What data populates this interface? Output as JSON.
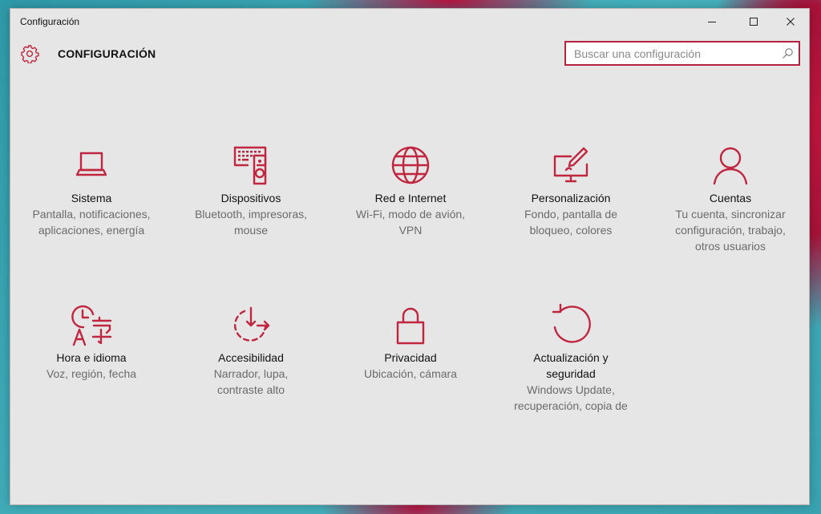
{
  "window": {
    "title": "Configuración"
  },
  "header": {
    "title": "CONFIGURACIÓN"
  },
  "search": {
    "placeholder": "Buscar una configuración",
    "value": ""
  },
  "tiles": [
    {
      "label": "Sistema",
      "desc": [
        "Pantalla, notificaciones,",
        "aplicaciones, energía"
      ],
      "icon": "laptop-icon"
    },
    {
      "label": "Dispositivos",
      "desc": [
        "Bluetooth, impresoras,",
        "mouse"
      ],
      "icon": "devices-icon"
    },
    {
      "label": "Red e Internet",
      "desc": [
        "Wi-Fi, modo de avión,",
        "VPN"
      ],
      "icon": "globe-icon"
    },
    {
      "label": "Personalización",
      "desc": [
        "Fondo, pantalla de",
        "bloqueo, colores"
      ],
      "icon": "paint-monitor-icon"
    },
    {
      "label": "Cuentas",
      "desc": [
        "Tu cuenta, sincronizar",
        "configuración, trabajo,",
        "otros usuarios"
      ],
      "icon": "person-icon"
    },
    {
      "label": "Hora e idioma",
      "desc": [
        "Voz, región, fecha"
      ],
      "icon": "time-language-icon"
    },
    {
      "label": "Accesibilidad",
      "desc": [
        "Narrador, lupa,",
        "contraste alto"
      ],
      "icon": "accessibility-icon"
    },
    {
      "label": "Privacidad",
      "desc": [
        "Ubicación, cámara"
      ],
      "icon": "lock-icon"
    },
    {
      "label": "Actualización y seguridad",
      "label_lines": [
        "Actualización y",
        "seguridad"
      ],
      "desc": [
        "Windows Update,",
        "recuperación, copia de"
      ],
      "icon": "update-icon"
    }
  ],
  "colors": {
    "accent": "#c0263f",
    "window_bg": "#e6e6e6"
  }
}
